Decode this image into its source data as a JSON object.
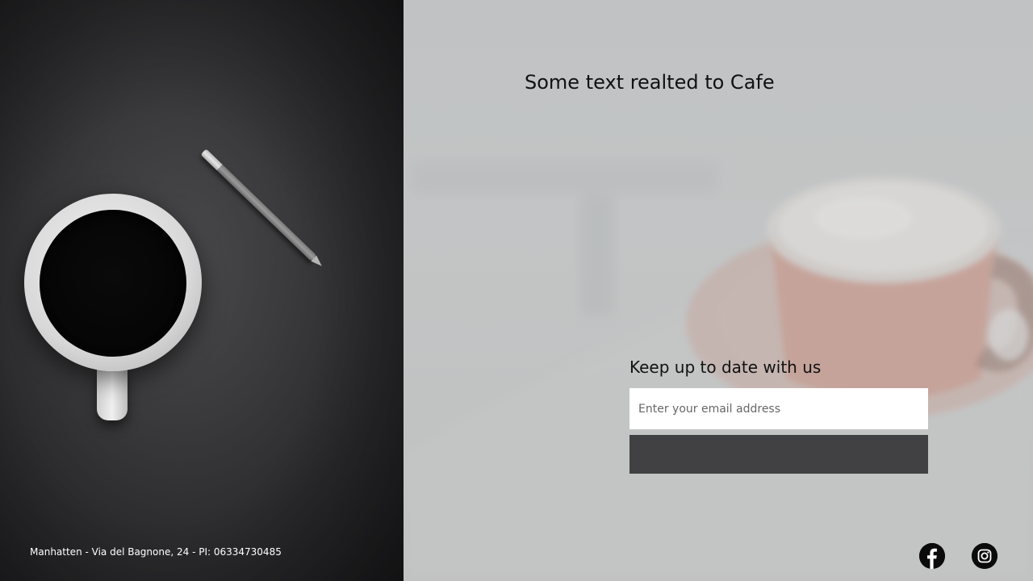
{
  "left_panel": {
    "address": "Manhatten - Via del Bagnone, 24 - PI: 06334730485"
  },
  "right_panel": {
    "headline": "Some text realted to Cafe",
    "newsletter": {
      "title": "Keep up to date with us",
      "email_placeholder": "Enter your email address",
      "email_value": "",
      "submit_label": ""
    },
    "social": [
      {
        "name": "facebook",
        "icon": "facebook-icon"
      },
      {
        "name": "instagram",
        "icon": "instagram-icon"
      }
    ]
  },
  "colors": {
    "left_bg": "#2e2e30",
    "right_bg": "#c1c2c3",
    "button_bg": "#414143",
    "text_dark": "#111111",
    "icon_bg": "#0b0b0b"
  }
}
